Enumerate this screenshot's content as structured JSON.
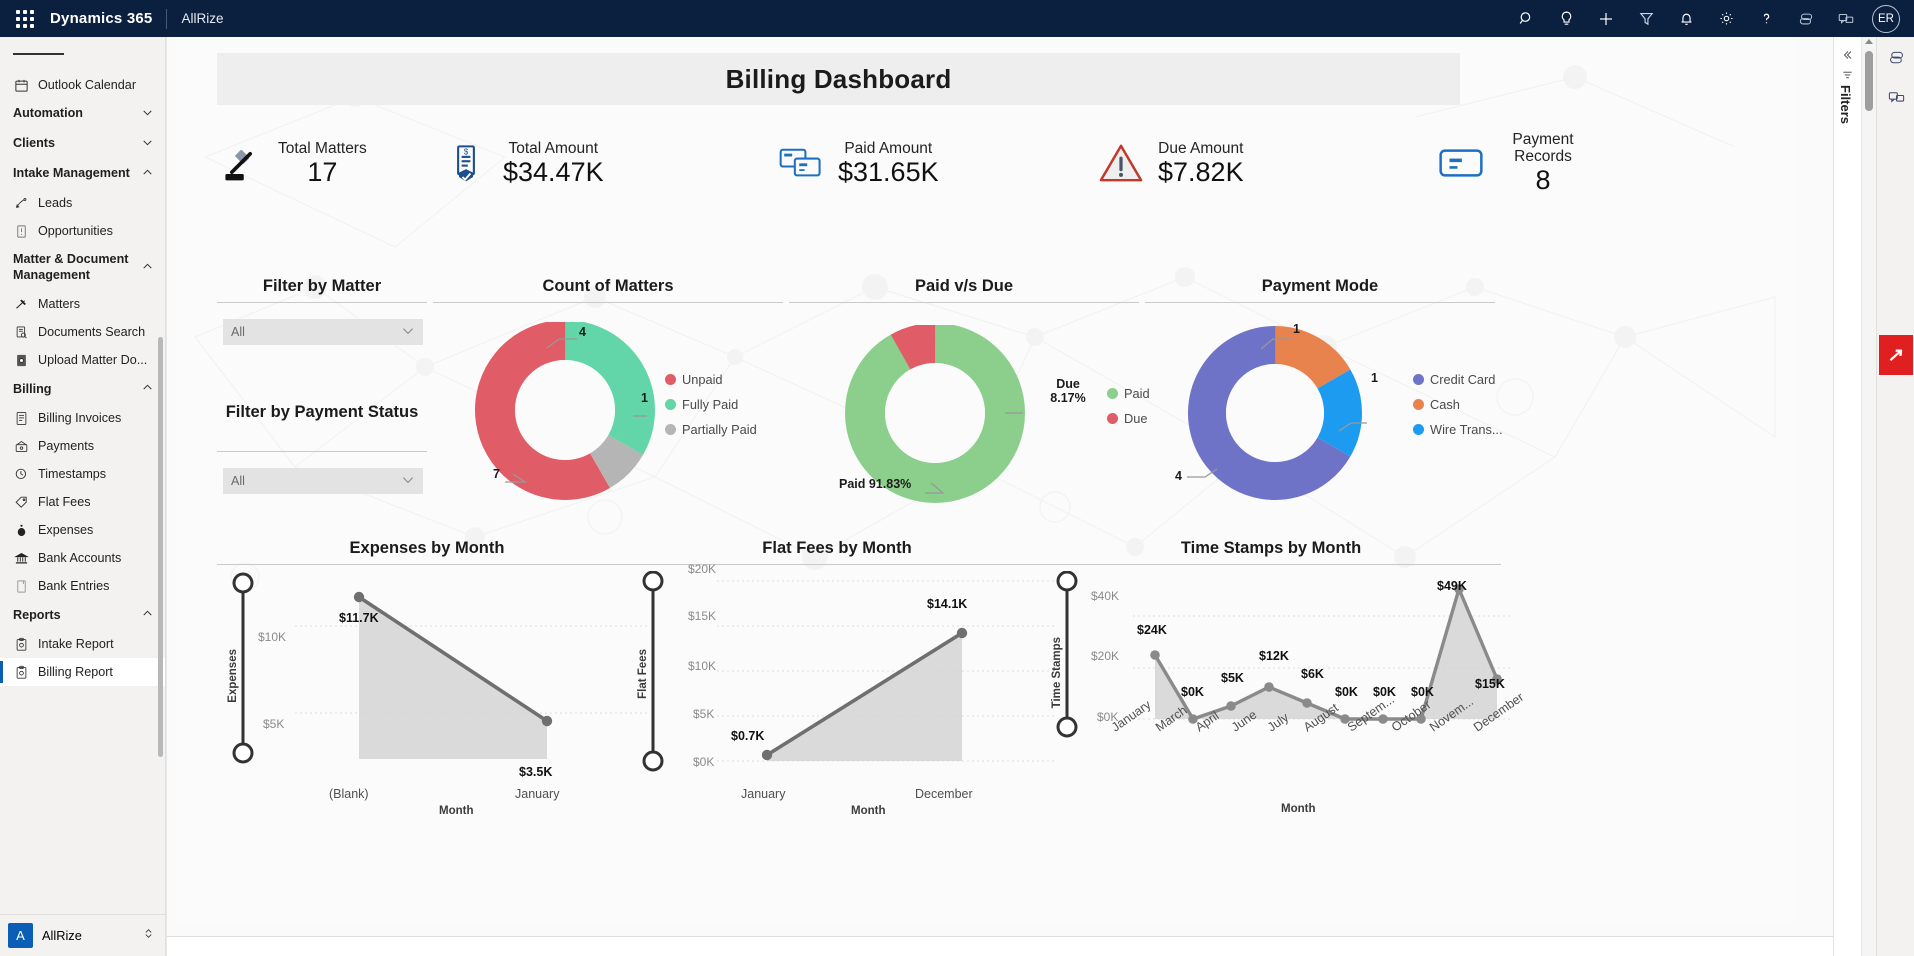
{
  "topbar": {
    "brand": "Dynamics 365",
    "app_name": "AllRize",
    "avatar_initials": "ER",
    "icons": [
      "search-icon",
      "lightbulb-icon",
      "plus-icon",
      "filter-icon",
      "bell-icon",
      "gear-icon",
      "help-icon",
      "copilot-icon",
      "feedback-icon"
    ]
  },
  "sidebar": {
    "items": [
      {
        "type": "item",
        "label": "Outlook Calendar",
        "icon": "calendar-icon"
      },
      {
        "type": "group",
        "label": "Automation",
        "chevron": "down"
      },
      {
        "type": "group",
        "label": "Clients",
        "chevron": "down"
      },
      {
        "type": "group",
        "label": "Intake Management",
        "chevron": "up"
      },
      {
        "type": "item",
        "label": "Leads",
        "icon": "lead-icon"
      },
      {
        "type": "item",
        "label": "Opportunities",
        "icon": "opportunity-icon"
      },
      {
        "type": "group",
        "label": "Matter & Document Management",
        "chevron": "up"
      },
      {
        "type": "item",
        "label": "Matters",
        "icon": "gavel-icon"
      },
      {
        "type": "item",
        "label": "Documents Search",
        "icon": "document-search-icon"
      },
      {
        "type": "item",
        "label": "Upload Matter Do...",
        "icon": "upload-icon"
      },
      {
        "type": "group",
        "label": "Billing",
        "chevron": "up"
      },
      {
        "type": "item",
        "label": "Billing Invoices",
        "icon": "invoice-icon"
      },
      {
        "type": "item",
        "label": "Payments",
        "icon": "payment-icon"
      },
      {
        "type": "item",
        "label": "Timestamps",
        "icon": "clock-icon"
      },
      {
        "type": "item",
        "label": "Flat Fees",
        "icon": "tag-icon"
      },
      {
        "type": "item",
        "label": "Expenses",
        "icon": "moneybag-icon"
      },
      {
        "type": "item",
        "label": "Bank Accounts",
        "icon": "bank-icon"
      },
      {
        "type": "item",
        "label": "Bank Entries",
        "icon": "entry-icon"
      },
      {
        "type": "group",
        "label": "Reports",
        "chevron": "up"
      },
      {
        "type": "item",
        "label": "Intake Report",
        "icon": "report-icon"
      },
      {
        "type": "item",
        "label": "Billing Report",
        "icon": "report-icon",
        "selected": true
      }
    ],
    "footer": {
      "initial": "A",
      "name": "AllRize"
    }
  },
  "report": {
    "title": "Billing Dashboard",
    "kpis": [
      {
        "label": "Total Matters",
        "value": "17",
        "icon": "gavel-icon"
      },
      {
        "label": "Total Amount",
        "value": "$34.47K",
        "icon": "invoice-dollar-icon"
      },
      {
        "label": "Paid Amount",
        "value": "$31.65K",
        "icon": "credit-cards-icon"
      },
      {
        "label": "Due Amount",
        "value": "$7.82K",
        "icon": "warning-icon"
      },
      {
        "label": "Payment Records",
        "value": "8",
        "icon": "record-card-icon"
      }
    ],
    "filters": {
      "matter": {
        "title": "Filter by Matter",
        "value": "All"
      },
      "payment_status": {
        "title": "Filter by Payment Status",
        "value": "All"
      }
    },
    "panel_titles": {
      "count_of_matters": "Count of Matters",
      "paid_vs_due": "Paid v/s Due",
      "payment_mode": "Payment Mode",
      "expenses_by_month": "Expenses by Month",
      "flat_fees_by_month": "Flat Fees by Month",
      "time_stamps_by_month": "Time Stamps by Month"
    }
  },
  "right_rail": {
    "filters_label": "Filters",
    "icons": [
      "copilot-icon",
      "feedback-icon",
      "zoho-icon"
    ]
  },
  "chart_data": [
    {
      "id": "count_of_matters",
      "type": "pie",
      "title": "Count of Matters",
      "labels": [
        "Unpaid",
        "Fully Paid",
        "Partially Paid"
      ],
      "values": [
        7,
        4,
        1
      ],
      "colors": [
        "#e05c66",
        "#62d6a8",
        "#b5b5b5"
      ],
      "legend_position": "right",
      "data_labels": [
        "7",
        "4",
        "1"
      ]
    },
    {
      "id": "paid_vs_due",
      "type": "pie",
      "title": "Paid v/s Due",
      "labels": [
        "Paid",
        "Due"
      ],
      "values": [
        91.83,
        8.17
      ],
      "colors": [
        "#8cce8c",
        "#e05c66"
      ],
      "legend_position": "right",
      "data_labels": [
        "Paid 91.83%",
        "Due 8.17%"
      ]
    },
    {
      "id": "payment_mode",
      "type": "pie",
      "title": "Payment Mode",
      "labels": [
        "Credit Card",
        "Cash",
        "Wire Trans..."
      ],
      "values": [
        4,
        1,
        1
      ],
      "colors": [
        "#6e73c7",
        "#e8834e",
        "#1d9bf0"
      ],
      "legend_position": "right",
      "data_labels": [
        "4",
        "1",
        "1"
      ]
    },
    {
      "id": "expenses_by_month",
      "type": "area",
      "title": "Expenses by Month",
      "xlabel": "Month",
      "ylabel": "Expenses",
      "categories": [
        "(Blank)",
        "January"
      ],
      "values": [
        11700,
        3500
      ],
      "data_labels": [
        "$11.7K",
        "$3.5K"
      ],
      "yticks": [
        "$5K",
        "$10K"
      ],
      "ylim": [
        0,
        13000
      ],
      "grid": true
    },
    {
      "id": "flat_fees_by_month",
      "type": "area",
      "title": "Flat Fees by Month",
      "xlabel": "Month",
      "ylabel": "Flat Fees",
      "categories": [
        "January",
        "December"
      ],
      "values": [
        700,
        14100
      ],
      "data_labels": [
        "$0.7K",
        "$14.1K"
      ],
      "yticks": [
        "$0K",
        "$5K",
        "$10K",
        "$15K",
        "$20K"
      ],
      "ylim": [
        0,
        20000
      ],
      "grid": true
    },
    {
      "id": "time_stamps_by_month",
      "type": "area",
      "title": "Time Stamps by Month",
      "xlabel": "Month",
      "ylabel": "Time Stamps",
      "categories": [
        "January",
        "March",
        "April",
        "June",
        "July",
        "August",
        "Septem...",
        "October",
        "Novem...",
        "December"
      ],
      "values": [
        24000,
        0,
        5000,
        12000,
        6000,
        0,
        0,
        0,
        49000,
        15000
      ],
      "data_labels": [
        "$24K",
        "$0K",
        "$5K",
        "$12K",
        "$6K",
        "$0K",
        "$0K",
        "$0K",
        "$49K",
        "$15K"
      ],
      "yticks": [
        "$0K",
        "$20K",
        "$40K"
      ],
      "ylim": [
        0,
        52000
      ],
      "grid": true
    }
  ]
}
